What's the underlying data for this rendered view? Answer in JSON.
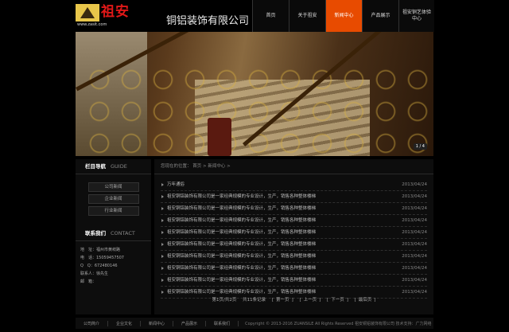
{
  "brand": {
    "logo_text": "祖安",
    "url": "www.zasit.com",
    "company_name": "铜铝装饰有限公司"
  },
  "nav": [
    {
      "label": "首页",
      "active": false
    },
    {
      "label": "关于祖安",
      "active": false
    },
    {
      "label": "新闻中心",
      "active": true
    },
    {
      "label": "产品展示",
      "active": false
    },
    {
      "label": "祖安铜艺体验中心",
      "active": false
    }
  ],
  "banner": {
    "pager": "1 / 4"
  },
  "sidebar": {
    "guide_title": "栏目导航",
    "guide_en": "GUIDE",
    "items": [
      "公司新闻",
      "企业新闻",
      "行业新闻"
    ],
    "contact_title": "联系我们",
    "contact_en": "CONTACT",
    "contact_rows": [
      "地　址：福州市黄岐路",
      "电　话：15059457507",
      "Q　Q：672480146",
      "联系人：徐先生",
      "邮　箱："
    ]
  },
  "content": {
    "breadcrumb": "您现在的位置： 首页 > 新闻中心 >",
    "news": [
      {
        "title": "万年通俗",
        "date": "2013/04/24"
      },
      {
        "title": "祖安铜铝装饰有限公司是一家经典规模的专业设计，生产，销售各种整体楼梯",
        "date": "2013/04/24"
      },
      {
        "title": "祖安铜铝装饰有限公司是一家经典规模的专业设计，生产，销售各种整体楼梯",
        "date": "2013/04/24"
      },
      {
        "title": "祖安铜铝装饰有限公司是一家经典规模的专业设计，生产，销售各种整体楼梯",
        "date": "2013/04/24"
      },
      {
        "title": "祖安铜铝装饰有限公司是一家经典规模的专业设计，生产，销售各种整体楼梯",
        "date": "2013/04/24"
      },
      {
        "title": "祖安铜铝装饰有限公司是一家经典规模的专业设计，生产，销售各种整体楼梯",
        "date": "2013/04/24"
      },
      {
        "title": "祖安铜铝装饰有限公司是一家经典规模的专业设计，生产，销售各种整体楼梯",
        "date": "2013/04/24"
      },
      {
        "title": "祖安铜铝装饰有限公司是一家经典规模的专业设计，生产，销售各种整体楼梯",
        "date": "2013/04/24"
      },
      {
        "title": "祖安铜铝装饰有限公司是一家经典规模的专业设计，生产，销售各种整体楼梯",
        "date": "2013/04/24"
      },
      {
        "title": "祖安铜铝装饰有限公司是一家经典规模的专业设计，生产，销售各种整体楼梯",
        "date": "2013/04/24"
      }
    ],
    "pagination": {
      "page_info": "第1页/共2页",
      "total": "共11条记录",
      "first": "第一页",
      "prev": "上一页",
      "next": "下一页",
      "last": "最后页"
    }
  },
  "footer": {
    "links": [
      "公司简介",
      "企业文化",
      "新闻中心",
      "产品展示",
      "联系我们"
    ],
    "copyright": "Copyright © 2013-2016 ZUANSILE All Rights Reserved 祖安铜铝装饰有限公司 技术支持：广力网络"
  }
}
